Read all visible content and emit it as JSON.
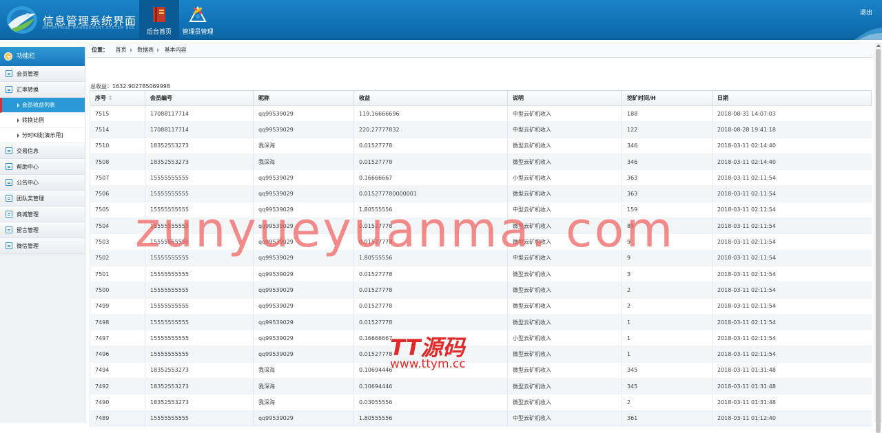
{
  "header": {
    "app_title": "信息管理系统界面",
    "app_subtitle": "ENTERPRISE MANAGEMENT SYSTEM BUS",
    "nav": [
      {
        "label": "后台首页",
        "icon": "book-icon",
        "active": true
      },
      {
        "label": "管理员管理",
        "icon": "admin-tools-icon",
        "active": false
      }
    ],
    "logout": "退出"
  },
  "sidebar": {
    "title": "功能栏",
    "items": [
      {
        "label": "会员管理",
        "icon": "list-icon"
      },
      {
        "label": "汇率转换",
        "icon": "list-icon"
      },
      {
        "label": "会员收益列表",
        "sub": true,
        "active": true
      },
      {
        "label": "转换比例",
        "sub": true
      },
      {
        "label": "分时K线[演示用]",
        "sub": true
      },
      {
        "label": "交易信息",
        "icon": "list-icon"
      },
      {
        "label": "帮助中心",
        "icon": "edit-icon"
      },
      {
        "label": "公告中心",
        "icon": "edit-icon"
      },
      {
        "label": "团队奖管理",
        "icon": "list-icon"
      },
      {
        "label": "商城管理",
        "icon": "list-icon"
      },
      {
        "label": "留言管理",
        "icon": "edit-icon"
      },
      {
        "label": "微信管理",
        "icon": "list-icon"
      }
    ]
  },
  "breadcrumb": {
    "prefix": "位置：",
    "items": [
      "首页",
      "数据表",
      "基本内容"
    ]
  },
  "total_income": "总收益：1632.902785069998",
  "table": {
    "columns": [
      "序号",
      "会员编号",
      "昵称",
      "收益",
      "说明",
      "挖矿时间/H",
      "日期"
    ],
    "sort_indicator": "⇕",
    "rows": [
      [
        "7515",
        "17088117714",
        "qq99539029",
        "119.16666696",
        "中型云矿机收入",
        "188",
        "2018-08-31 14:07:03"
      ],
      [
        "7514",
        "17088117714",
        "qq99539029",
        "220.27777832",
        "中型云矿机收入",
        "122",
        "2018-08-28 19:41:18"
      ],
      [
        "7510",
        "18352553273",
        "我深海",
        "0.01527778",
        "微型云矿机收入",
        "346",
        "2018-03-11 02:14:40"
      ],
      [
        "7508",
        "18352553273",
        "我深海",
        "0.01527778",
        "微型云矿机收入",
        "346",
        "2018-03-11 02:14:40"
      ],
      [
        "7507",
        "15555555555",
        "qq99539029",
        "0.16666667",
        "小型云矿机收入",
        "363",
        "2018-03-11 02:11:54"
      ],
      [
        "7506",
        "15555555555",
        "qq99539029",
        "0.015277780000001",
        "微型云矿机收入",
        "363",
        "2018-03-11 02:11:54"
      ],
      [
        "7505",
        "15555555555",
        "qq99539029",
        "1.80555556",
        "中型云矿机收入",
        "159",
        "2018-03-11 02:11:54"
      ],
      [
        "7504",
        "15555555555",
        "qq99539029",
        "0.01527778",
        "微型云矿机收入",
        "85",
        "2018-03-11 02:11:54"
      ],
      [
        "7503",
        "15555555555",
        "qq99539029",
        "0.01527778",
        "微型云矿机收入",
        "9",
        "2018-03-11 02:11:54"
      ],
      [
        "7502",
        "15555555555",
        "qq99539029",
        "1.80555556",
        "中型云矿机收入",
        "9",
        "2018-03-11 02:11:54"
      ],
      [
        "7501",
        "15555555555",
        "qq99539029",
        "0.01527778",
        "微型云矿机收入",
        "3",
        "2018-03-11 02:11:54"
      ],
      [
        "7500",
        "15555555555",
        "qq99539029",
        "0.01527778",
        "微型云矿机收入",
        "2",
        "2018-03-11 02:11:54"
      ],
      [
        "7499",
        "15555555555",
        "qq99539029",
        "0.01527778",
        "微型云矿机收入",
        "2",
        "2018-03-11 02:11:54"
      ],
      [
        "7498",
        "15555555555",
        "qq99539029",
        "0.01527778",
        "微型云矿机收入",
        "1",
        "2018-03-11 02:11:54"
      ],
      [
        "7497",
        "15555555555",
        "qq99539029",
        "0.16666667",
        "小型云矿机收入",
        "1",
        "2018-03-11 02:11:54"
      ],
      [
        "7496",
        "15555555555",
        "qq99539029",
        "0.01527778",
        "微型云矿机收入",
        "1",
        "2018-03-11 02:11:54"
      ],
      [
        "7494",
        "18352553273",
        "我深海",
        "0.10694446",
        "微型云矿机收入",
        "345",
        "2018-03-11 01:31:48"
      ],
      [
        "7492",
        "18352553273",
        "我深海",
        "0.10694446",
        "微型云矿机收入",
        "345",
        "2018-03-11 01:31:48"
      ],
      [
        "7490",
        "18352553273",
        "我深海",
        "0.03055556",
        "微型云矿机收入",
        "2",
        "2018-03-11 01:31:48"
      ],
      [
        "7489",
        "15555555555",
        "qq99539029",
        "1.80555556",
        "中型云矿机收入",
        "361",
        "2018-03-11 01:12:40"
      ]
    ]
  },
  "watermarks": {
    "main": "zunyueyuanma. com",
    "brand": "TT源码",
    "brand_url": "www.ttym.cc"
  },
  "colors": {
    "header_blue": "#1174b8",
    "active_blue": "#2a9ad7",
    "active_marker": "#d53030"
  }
}
